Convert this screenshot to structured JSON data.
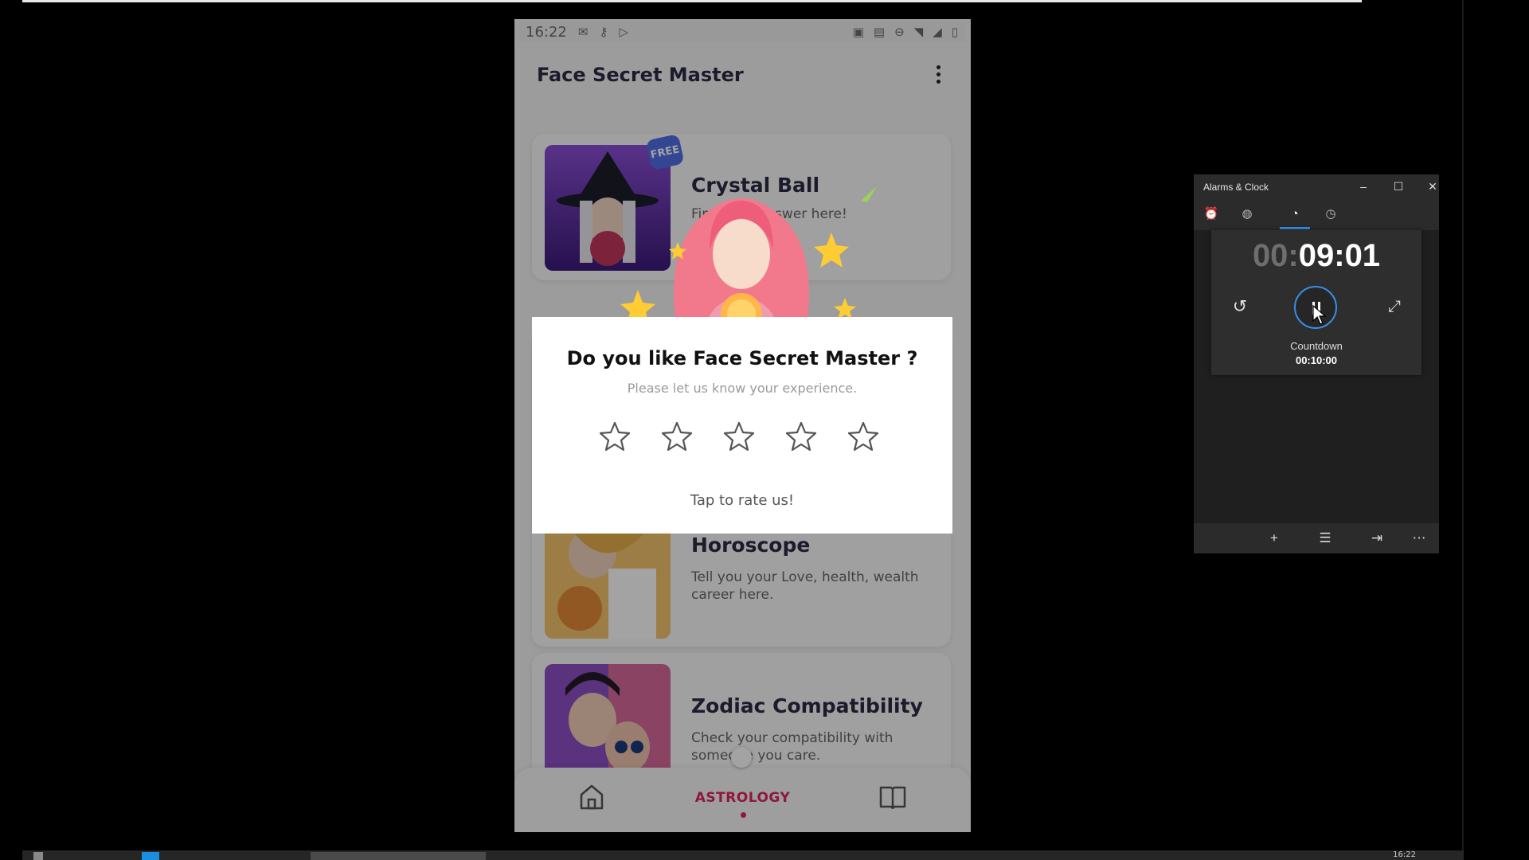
{
  "status_bar": {
    "time": "16:22"
  },
  "app": {
    "title": "Face Secret Master"
  },
  "cards": [
    {
      "title": "Crystal Ball",
      "desc": "Find your answer here!",
      "badge": "FREE"
    },
    {
      "title": "Horoscope",
      "desc": "Tell you your Love, health, wealth career here."
    },
    {
      "title": "Zodiac Compatibility",
      "desc": "Check your compatibility with someone you care."
    }
  ],
  "rate_dialog": {
    "title": "Do you like Face Secret Master ?",
    "subtitle": "Please let us know your experience.",
    "stars_total": 5,
    "stars_selected": 0,
    "tap_text": "Tap to rate us!"
  },
  "bottom_nav": {
    "active_label": "ASTROLOGY"
  },
  "clock_window": {
    "title": "Alarms & Clock",
    "timer_hours": "00:",
    "timer_rest": "09:01",
    "timer_name": "Countdown",
    "timer_total": "00:10:00"
  },
  "taskbar": {
    "clock": "16:22"
  },
  "colors": {
    "accent_pink": "#e0245e",
    "clock_accent": "#3a8ee6",
    "badge_blue": "#4f6ee6"
  }
}
